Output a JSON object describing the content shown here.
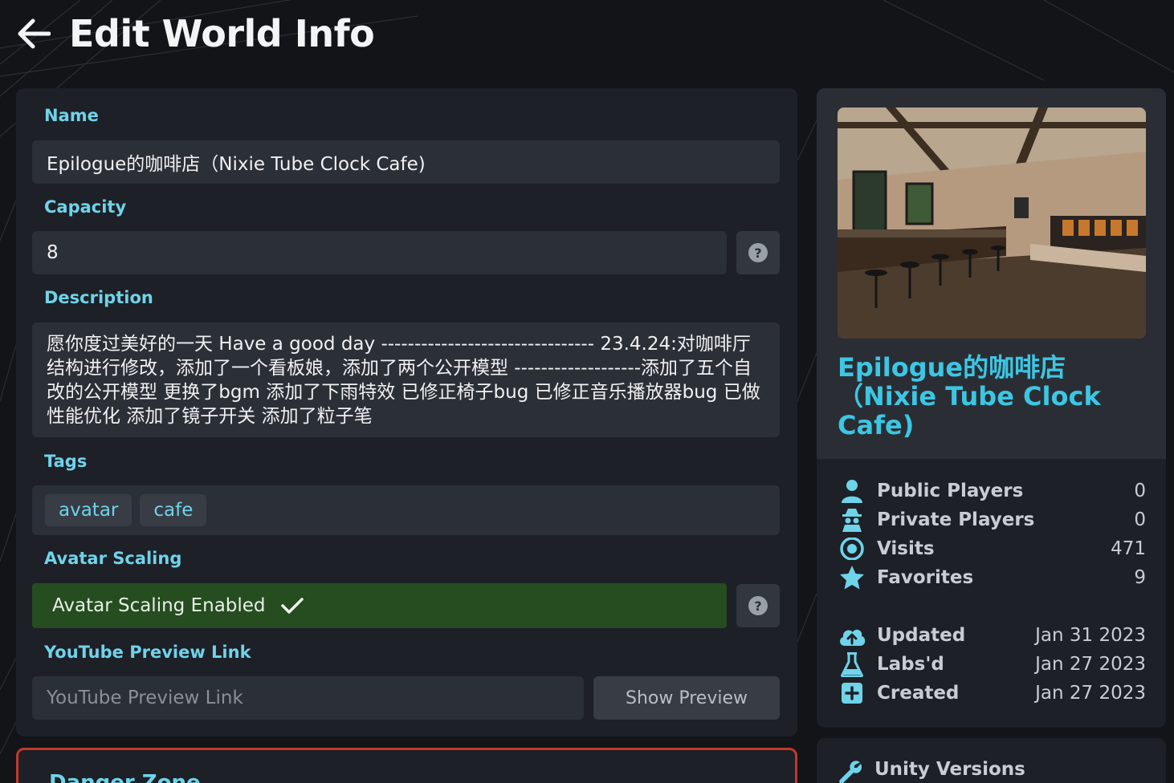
{
  "header": {
    "title": "Edit World Info"
  },
  "form": {
    "name_label": "Name",
    "name_value": "Epilogue的咖啡店（Nixie Tube Clock Cafe)",
    "capacity_label": "Capacity",
    "capacity_value": "8",
    "help_glyph": "?",
    "description_label": "Description",
    "description_value": "愿你度过美好的一天 Have a good day -------------------------------- 23.4.24:对咖啡厅结构进行修改，添加了一个看板娘，添加了两个公开模型 -------------------添加了五个自改的公开模型 更换了bgm 添加了下雨特效 已修正椅子bug 已修正音乐播放器bug 已做性能优化 添加了镜子开关 添加了粒子笔",
    "tags_label": "Tags",
    "tags": [
      "avatar",
      "cafe"
    ],
    "avatar_scaling_label": "Avatar Scaling",
    "avatar_scaling_value": "Avatar Scaling Enabled",
    "youtube_label": "YouTube Preview Link",
    "youtube_placeholder": "YouTube Preview Link",
    "youtube_value": "",
    "show_preview_label": "Show Preview"
  },
  "danger": {
    "title": "Danger Zone"
  },
  "sidebar": {
    "world_name": "Epilogue的咖啡店（Nixie Tube Clock Cafe)",
    "stats": [
      {
        "label": "Public Players",
        "value": "0",
        "icon": "person-icon"
      },
      {
        "label": "Private Players",
        "value": "0",
        "icon": "spy-icon"
      },
      {
        "label": "Visits",
        "value": "471",
        "icon": "eye-icon"
      },
      {
        "label": "Favorites",
        "value": "9",
        "icon": "star-icon"
      }
    ],
    "dates": [
      {
        "label": "Updated",
        "value": "Jan 31 2023",
        "icon": "cloud-upload-icon"
      },
      {
        "label": "Labs'd",
        "value": "Jan 27 2023",
        "icon": "flask-icon"
      },
      {
        "label": "Created",
        "value": "Jan 27 2023",
        "icon": "plus-square-icon"
      }
    ],
    "unity_title": "Unity Versions"
  },
  "colors": {
    "accent": "#6fd3ea",
    "world_name": "#3cc6e4",
    "enabled_green": "#254d20",
    "danger_border": "#c0392b",
    "icon": "#6fd3ea"
  }
}
